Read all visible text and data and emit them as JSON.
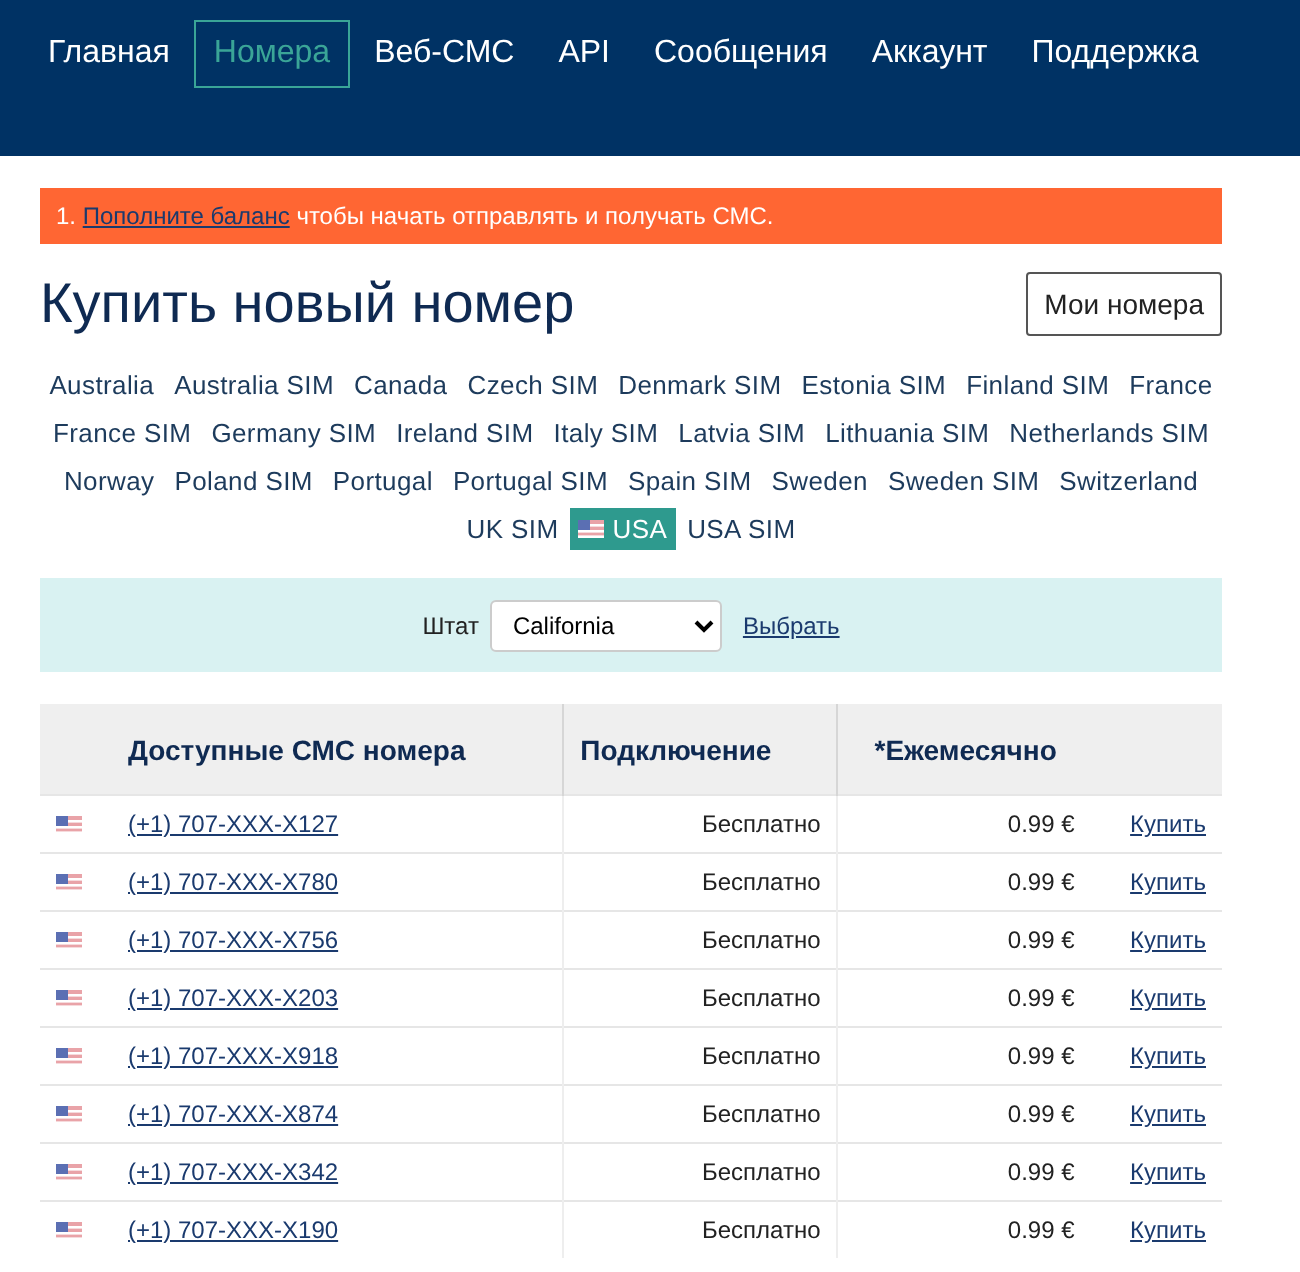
{
  "nav": [
    {
      "label": "Главная",
      "selected": false
    },
    {
      "label": "Номера",
      "selected": true
    },
    {
      "label": "Веб-СМС",
      "selected": false
    },
    {
      "label": "API",
      "selected": false
    },
    {
      "label": "Сообщения",
      "selected": false
    },
    {
      "label": "Аккаунт",
      "selected": false
    },
    {
      "label": "Поддержка",
      "selected": false
    }
  ],
  "alert": {
    "number": "1.",
    "link": "Пополните баланс",
    "text": "чтобы начать отправлять и получать СМС."
  },
  "title": "Купить новый номер",
  "my_numbers_button": "Мои номера",
  "countries": [
    {
      "label": "Australia",
      "selected": false
    },
    {
      "label": "Australia SIM",
      "selected": false
    },
    {
      "label": "Canada",
      "selected": false
    },
    {
      "label": "Czech SIM",
      "selected": false
    },
    {
      "label": "Denmark SIM",
      "selected": false
    },
    {
      "label": "Estonia SIM",
      "selected": false
    },
    {
      "label": "Finland SIM",
      "selected": false
    },
    {
      "label": "France",
      "selected": false
    },
    {
      "label": "France SIM",
      "selected": false
    },
    {
      "label": "Germany SIM",
      "selected": false
    },
    {
      "label": "Ireland SIM",
      "selected": false
    },
    {
      "label": "Italy SIM",
      "selected": false
    },
    {
      "label": "Latvia SIM",
      "selected": false
    },
    {
      "label": "Lithuania SIM",
      "selected": false
    },
    {
      "label": "Netherlands SIM",
      "selected": false
    },
    {
      "label": "Norway",
      "selected": false
    },
    {
      "label": "Poland SIM",
      "selected": false
    },
    {
      "label": "Portugal",
      "selected": false
    },
    {
      "label": "Portugal SIM",
      "selected": false
    },
    {
      "label": "Spain SIM",
      "selected": false
    },
    {
      "label": "Sweden",
      "selected": false
    },
    {
      "label": "Sweden SIM",
      "selected": false
    },
    {
      "label": "Switzerland",
      "selected": false
    },
    {
      "label": "UK SIM",
      "selected": false
    },
    {
      "label": "USA",
      "selected": true
    },
    {
      "label": "USA SIM",
      "selected": false
    }
  ],
  "filter": {
    "label": "Штат",
    "value": "California",
    "button": "Выбрать"
  },
  "table": {
    "columns": [
      "Доступные СМС номера",
      "Подключение",
      "*Ежемесячно"
    ],
    "rows": [
      {
        "number": "(+1) 707-XXX-X127",
        "connection": "Бесплатно",
        "monthly": "0.99 €",
        "action": "Купить"
      },
      {
        "number": "(+1) 707-XXX-X780",
        "connection": "Бесплатно",
        "monthly": "0.99 €",
        "action": "Купить"
      },
      {
        "number": "(+1) 707-XXX-X756",
        "connection": "Бесплатно",
        "monthly": "0.99 €",
        "action": "Купить"
      },
      {
        "number": "(+1) 707-XXX-X203",
        "connection": "Бесплатно",
        "monthly": "0.99 €",
        "action": "Купить"
      },
      {
        "number": "(+1) 707-XXX-X918",
        "connection": "Бесплатно",
        "monthly": "0.99 €",
        "action": "Купить"
      },
      {
        "number": "(+1) 707-XXX-X874",
        "connection": "Бесплатно",
        "monthly": "0.99 €",
        "action": "Купить"
      },
      {
        "number": "(+1) 707-XXX-X342",
        "connection": "Бесплатно",
        "monthly": "0.99 €",
        "action": "Купить"
      },
      {
        "number": "(+1) 707-XXX-X190",
        "connection": "Бесплатно",
        "monthly": "0.99 €",
        "action": "Купить"
      }
    ]
  }
}
